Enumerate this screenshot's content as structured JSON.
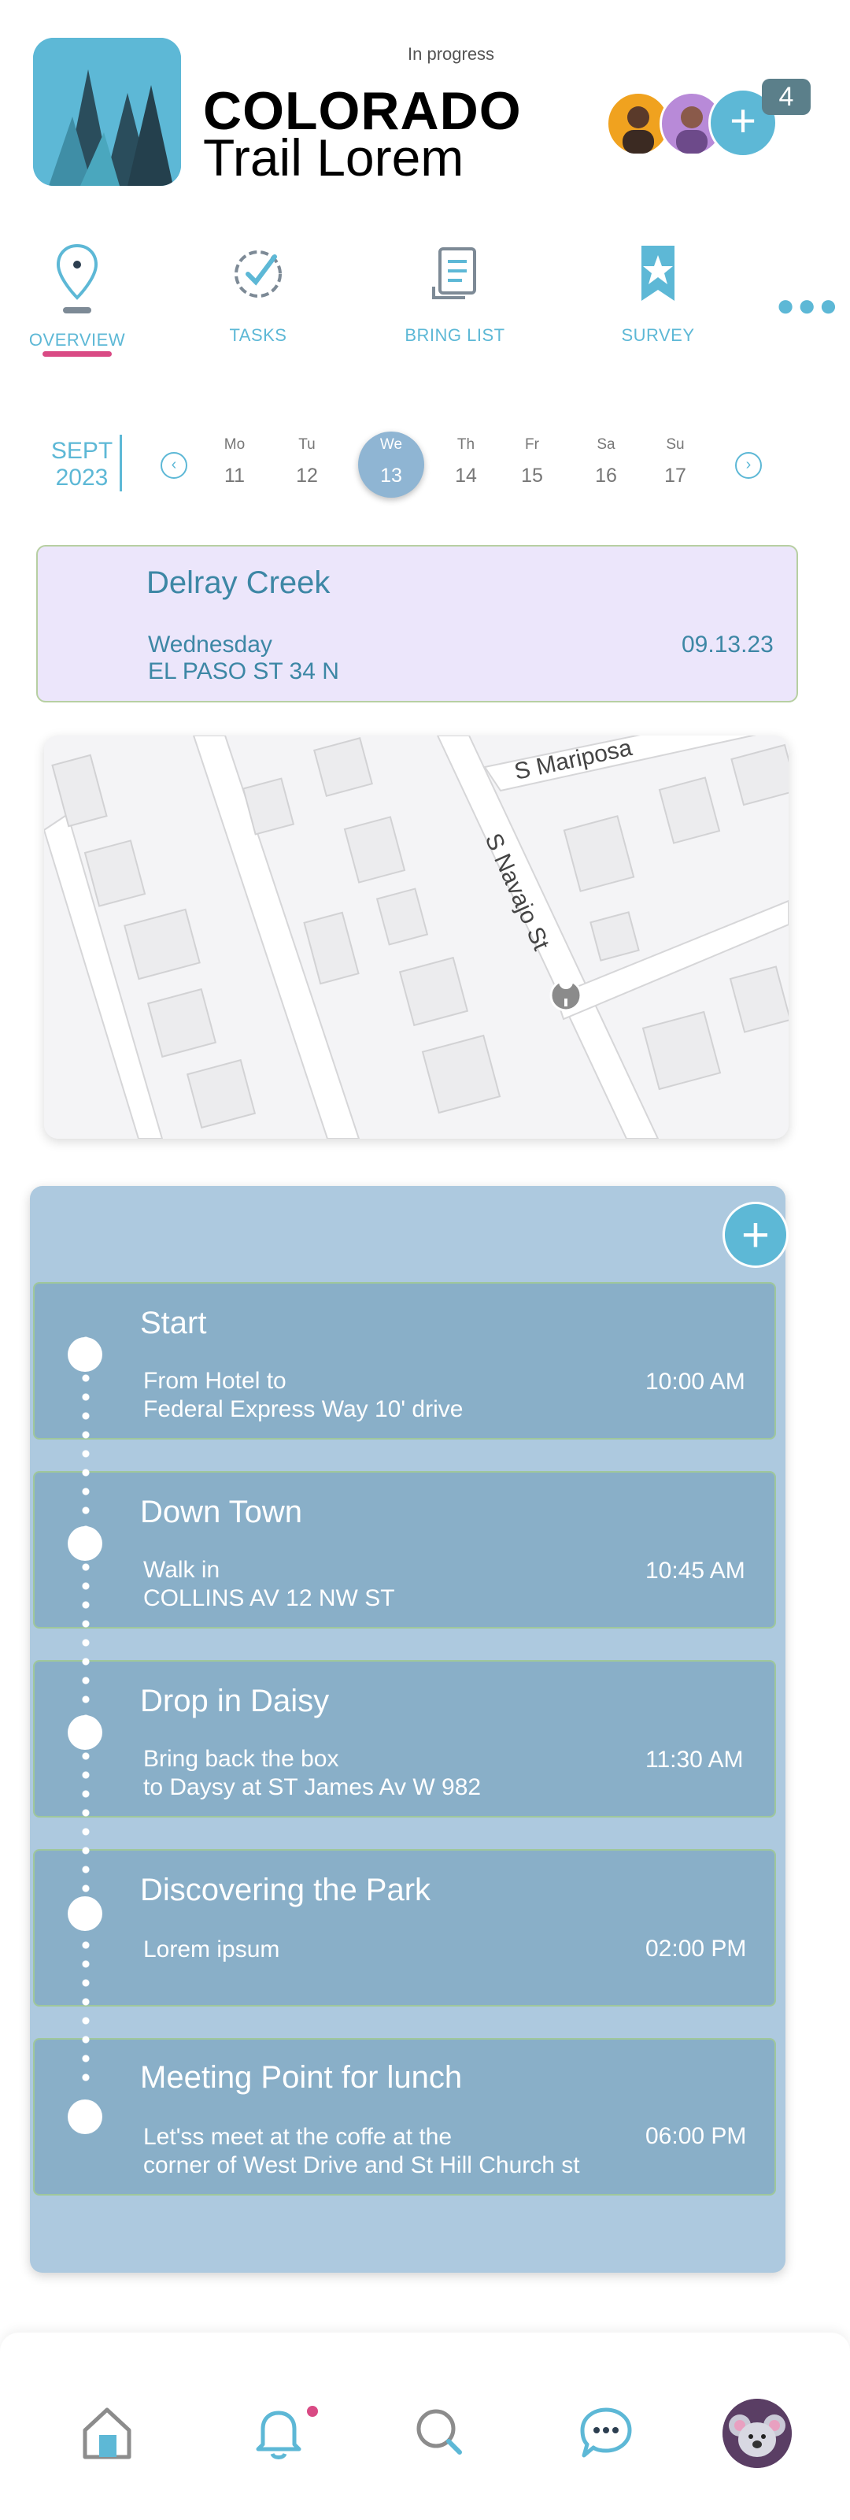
{
  "header": {
    "status": "In progress",
    "title_line1": "COLORADO",
    "title_line2": "Trail Lorem",
    "participants_extra_count": "4",
    "add_participant_label": "+"
  },
  "tabs": [
    {
      "label": "OVERVIEW",
      "icon": "location-pin-icon",
      "active": true
    },
    {
      "label": "TASKS",
      "icon": "check-circle-icon",
      "active": false
    },
    {
      "label": "BRING LIST",
      "icon": "list-document-icon",
      "active": false
    },
    {
      "label": "SURVEY",
      "icon": "star-bookmark-icon",
      "active": false
    }
  ],
  "calendar": {
    "month": "SEPT",
    "year": "2023",
    "days": [
      {
        "name": "Mo",
        "num": "11"
      },
      {
        "name": "Tu",
        "num": "12"
      },
      {
        "name": "We",
        "num": "13",
        "selected": true
      },
      {
        "name": "Th",
        "num": "14"
      },
      {
        "name": "Fr",
        "num": "15"
      },
      {
        "name": "Sa",
        "num": "16"
      },
      {
        "name": "Su",
        "num": "17"
      }
    ]
  },
  "destination": {
    "title": "Delray Creek",
    "weekday": "Wednesday",
    "address": "EL PASO ST 34 N",
    "date": "09.13.23"
  },
  "map": {
    "street_1": "S Mariposa",
    "street_2": "S Navajo St"
  },
  "timeline": {
    "add_label": "+",
    "stops": [
      {
        "title": "Start",
        "desc_line1": "From Hotel to",
        "desc_line2": "Federal Express Way 10' drive",
        "time": "10:00 AM"
      },
      {
        "title": "Down Town",
        "desc_line1": "Walk in",
        "desc_line2": "COLLINS AV 12 NW ST",
        "time": "10:45 AM"
      },
      {
        "title": "Drop in Daisy",
        "desc_line1": "Bring back the box",
        "desc_line2": "to Daysy at ST James Av W 982",
        "time": "11:30 AM"
      },
      {
        "title": "Discovering the Park",
        "desc_line1": "Lorem ipsum",
        "desc_line2": "",
        "time": "02:00 PM"
      },
      {
        "title": "Meeting Point for lunch",
        "desc_line1": "Let'ss meet  at the coffe at the",
        "desc_line2": "corner of West Drive and St Hill Church st",
        "time": "06:00 PM"
      }
    ]
  },
  "bottom_nav": [
    {
      "icon": "home-icon"
    },
    {
      "icon": "bell-icon"
    },
    {
      "icon": "search-icon"
    },
    {
      "icon": "chat-icon"
    },
    {
      "icon": "profile-avatar"
    }
  ],
  "colors": {
    "accent": "#5db8d6",
    "tab_underline": "#d94a84",
    "destination_bg": "#ece6fb",
    "timeline_bg": "#adc9df",
    "stop_card_bg": "#89afc8"
  }
}
